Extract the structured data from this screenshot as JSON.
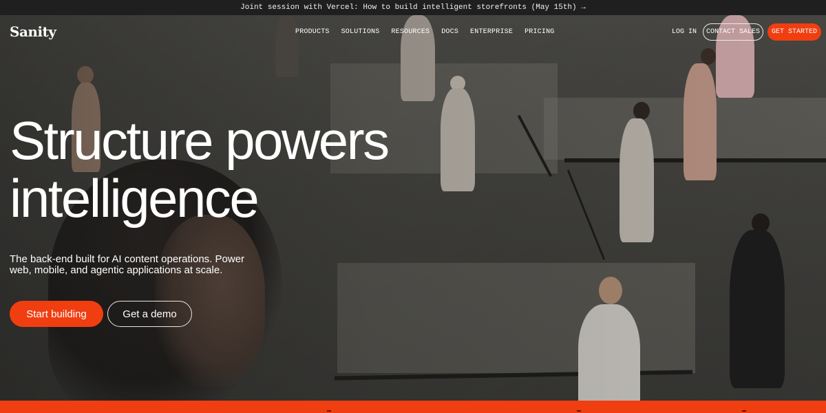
{
  "announcement": {
    "text": "Joint session with Vercel: How to build intelligent storefronts (May 15th) →"
  },
  "nav": {
    "logo": "Sanity",
    "menu": [
      "PRODUCTS",
      "SOLUTIONS",
      "RESOURCES",
      "DOCS",
      "ENTERPRISE",
      "PRICING"
    ],
    "login": "LOG IN",
    "contact": "CONTACT SALES",
    "get_started": "GET STARTED"
  },
  "hero": {
    "headline_line1": "Structure powers",
    "headline_line2": "intelligence",
    "subtext": "The back-end built for AI content operations. Power web, mobile, and agentic applications at scale.",
    "primary_cta": "Start building",
    "secondary_cta": "Get a demo"
  },
  "colors": {
    "accent": "#f03e11",
    "announcement_bg": "#1f1f1f"
  }
}
